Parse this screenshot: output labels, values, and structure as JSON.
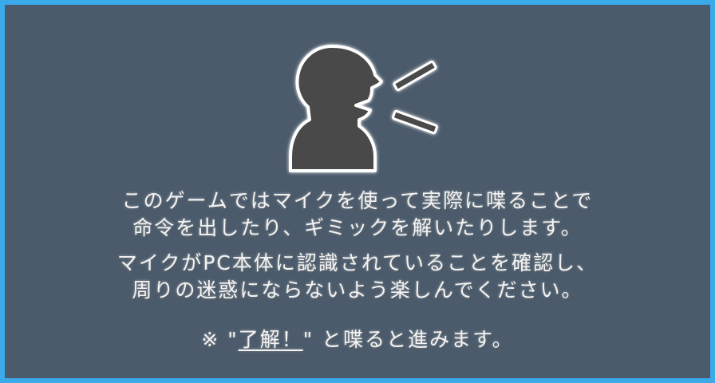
{
  "colors": {
    "frame": "#3aaaea",
    "panel": "#4b5b6b",
    "icon_fill": "#4a4a4a",
    "icon_outline": "#ffffff",
    "text": "#f3f3f3"
  },
  "icon": {
    "name": "speaking-person-icon"
  },
  "instructions": {
    "paragraph1": {
      "line1": "このゲームではマイクを使って実際に喋ることで",
      "line2": "命令を出したり、ギミックを解いたりします。"
    },
    "paragraph2": {
      "line1": "マイクがPC本体に認識されていることを確認し、",
      "line2": "周りの迷惑にならないよう楽しんでください。"
    },
    "prompt": {
      "prefix": "※ \"",
      "keyword": "了解！",
      "suffix": "\" と喋ると進みます。"
    }
  }
}
